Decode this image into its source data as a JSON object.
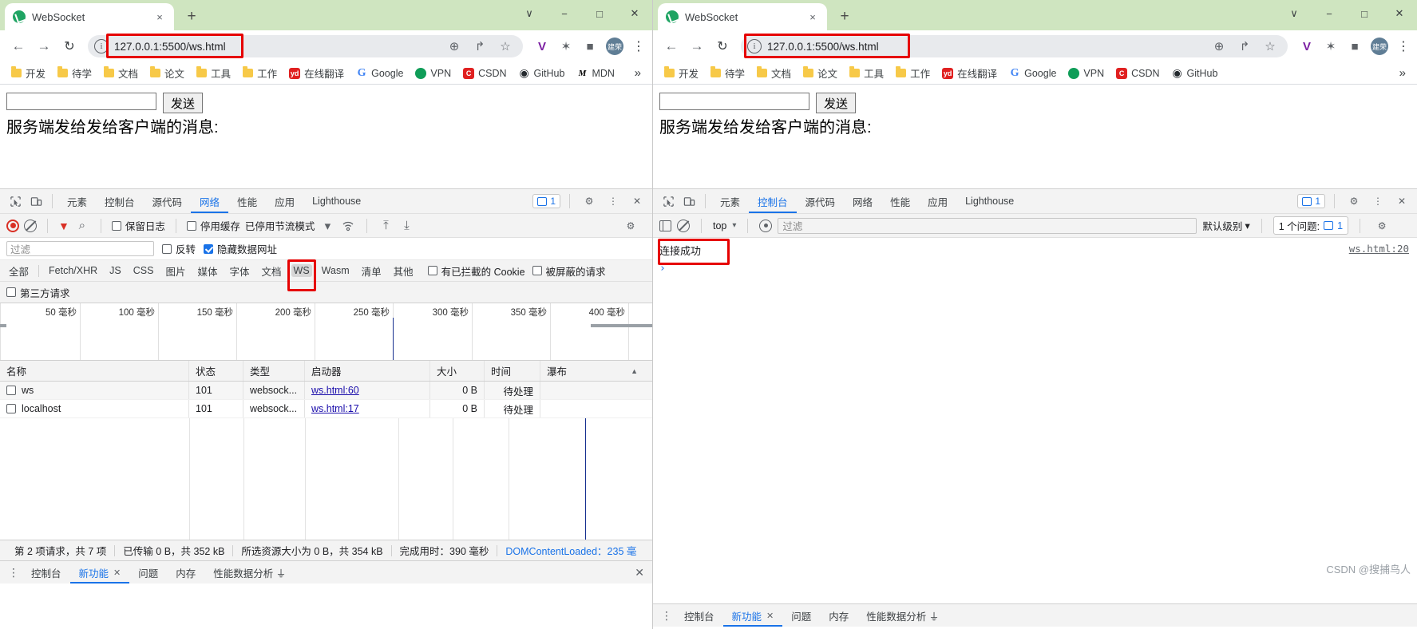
{
  "left_window": {
    "tab": {
      "title": "WebSocket",
      "close": "×",
      "favicon_name": "websocket-globe-icon"
    },
    "newtab_label": "+",
    "window_controls": {
      "chevron": "∨",
      "minimize": "−",
      "maximize": "□",
      "close": "✕"
    },
    "toolbar": {
      "back": "←",
      "forward": "→",
      "reload": "↻",
      "info": "ⓘ",
      "url": "127.0.0.1:5500/ws.html",
      "zoom_icon": "⊕",
      "share_icon": "↱",
      "star_icon": "☆",
      "ext1": "V",
      "ext2": "✶",
      "ext3": "■",
      "avatar": "建荣",
      "kebab": "⋮"
    },
    "bookmarks": [
      {
        "label": "开发",
        "icon": "folder-icon"
      },
      {
        "label": "待学",
        "icon": "folder-icon"
      },
      {
        "label": "文档",
        "icon": "folder-icon"
      },
      {
        "label": "论文",
        "icon": "folder-icon"
      },
      {
        "label": "工具",
        "icon": "folder-icon"
      },
      {
        "label": "工作",
        "icon": "folder-icon"
      },
      {
        "label": "在线翻译",
        "icon": "youdao-icon",
        "glyph": "yd"
      },
      {
        "label": "Google",
        "icon": "google-icon",
        "glyph": "G"
      },
      {
        "label": "VPN",
        "icon": "vpn-icon",
        "glyph": "●"
      },
      {
        "label": "CSDN",
        "icon": "csdn-icon",
        "glyph": "C"
      },
      {
        "label": "GitHub",
        "icon": "github-icon",
        "glyph": "●"
      },
      {
        "label": "MDN",
        "icon": "mdn-icon",
        "glyph": "M"
      }
    ],
    "bookmarks_overflow": "»",
    "page": {
      "input_value": "",
      "input_placeholder": "",
      "send_button": "发送",
      "server_text": "服务端发给发给客户端的消息:"
    },
    "devtools": {
      "tabs": [
        {
          "label": "元素",
          "active": false
        },
        {
          "label": "控制台",
          "active": false
        },
        {
          "label": "源代码",
          "active": false
        },
        {
          "label": "网络",
          "active": true
        },
        {
          "label": "性能",
          "active": false
        },
        {
          "label": "应用",
          "active": false
        },
        {
          "label": "Lighthouse",
          "active": false
        }
      ],
      "message_badge": "1",
      "settings_icon": "⚙",
      "kebab": "⋮",
      "close": "✕",
      "network_toolbar": {
        "record": "record-icon",
        "clear": "clear-icon",
        "filter": "▼",
        "search": "⌕",
        "preserve_log": "保留日志",
        "disable_cache": "停用缓存",
        "throttling": "已停用节流模式",
        "throttling_caret": "▾",
        "import": "⤒",
        "export": "⤓"
      },
      "filter_placeholder": "过滤",
      "invert_label": "反转",
      "hide_data_urls_label": "隐藏数据网址",
      "hide_data_urls_checked": true,
      "types": [
        "全部",
        "Fetch/XHR",
        "JS",
        "CSS",
        "图片",
        "媒体",
        "字体",
        "文档",
        "WS",
        "Wasm",
        "清单",
        "其他"
      ],
      "selected_type": "WS",
      "blocked_cookies_label": "有已拦截的 Cookie",
      "blocked_requests_label": "被屏蔽的请求",
      "third_party_label": "第三方请求",
      "timeline_ticks": [
        "50 毫秒",
        "100 毫秒",
        "150 毫秒",
        "200 毫秒",
        "250 毫秒",
        "300 毫秒",
        "350 毫秒",
        "400 毫秒"
      ],
      "table": {
        "columns": [
          "名称",
          "状态",
          "类型",
          "启动器",
          "大小",
          "时间",
          "瀑布"
        ],
        "sort_caret": "▲",
        "rows": [
          {
            "name": "ws",
            "status": "101",
            "type": "websock...",
            "initiator": "ws.html:60",
            "size": "0 B",
            "time": "待处理"
          },
          {
            "name": "localhost",
            "status": "101",
            "type": "websock...",
            "initiator": "ws.html:17",
            "size": "0 B",
            "time": "待处理"
          }
        ]
      },
      "status_bar": {
        "requests": "第 2 项请求，共 7 项",
        "transferred": "已传输 0 B，共 352 kB",
        "resources": "所选资源大小为 0 B，共 354 kB",
        "finish": "完成用时：390 毫秒",
        "domcontentloaded": "DOMContentLoaded：235 毫"
      },
      "drawer": {
        "kebab": "⋮",
        "tabs": [
          {
            "label": "控制台",
            "active": false,
            "closable": false
          },
          {
            "label": "新功能",
            "active": true,
            "closable": true
          },
          {
            "label": "问题",
            "active": false,
            "closable": false
          },
          {
            "label": "内存",
            "active": false,
            "closable": false
          },
          {
            "label": "性能数据分析 ⏚",
            "active": false,
            "closable": false
          }
        ],
        "close": "✕"
      }
    }
  },
  "right_window": {
    "tab": {
      "title": "WebSocket",
      "close": "×",
      "favicon_name": "websocket-globe-icon"
    },
    "newtab_label": "+",
    "window_controls": {
      "chevron": "∨",
      "minimize": "−",
      "maximize": "□",
      "close": "✕"
    },
    "toolbar": {
      "back": "←",
      "forward": "→",
      "reload": "↻",
      "info": "ⓘ",
      "url": "127.0.0.1:5500/ws.html",
      "zoom_icon": "⊕",
      "share_icon": "↱",
      "star_icon": "☆",
      "ext1": "V",
      "ext2": "✶",
      "ext3": "■",
      "avatar": "建荣",
      "kebab": "⋮"
    },
    "bookmarks": [
      {
        "label": "开发",
        "icon": "folder-icon"
      },
      {
        "label": "待学",
        "icon": "folder-icon"
      },
      {
        "label": "文档",
        "icon": "folder-icon"
      },
      {
        "label": "论文",
        "icon": "folder-icon"
      },
      {
        "label": "工具",
        "icon": "folder-icon"
      },
      {
        "label": "工作",
        "icon": "folder-icon"
      },
      {
        "label": "在线翻译",
        "icon": "youdao-icon",
        "glyph": "yd"
      },
      {
        "label": "Google",
        "icon": "google-icon",
        "glyph": "G"
      },
      {
        "label": "VPN",
        "icon": "vpn-icon",
        "glyph": "●"
      },
      {
        "label": "CSDN",
        "icon": "csdn-icon",
        "glyph": "C"
      },
      {
        "label": "GitHub",
        "icon": "github-icon",
        "glyph": "●"
      }
    ],
    "bookmarks_overflow": "»",
    "page": {
      "input_value": "",
      "input_placeholder": "",
      "send_button": "发送",
      "server_text": "服务端发给发给客户端的消息:"
    },
    "devtools": {
      "tabs": [
        {
          "label": "元素",
          "active": false
        },
        {
          "label": "控制台",
          "active": true
        },
        {
          "label": "源代码",
          "active": false
        },
        {
          "label": "网络",
          "active": false
        },
        {
          "label": "性能",
          "active": false
        },
        {
          "label": "应用",
          "active": false
        },
        {
          "label": "Lighthouse",
          "active": false
        }
      ],
      "message_badge": "1",
      "settings_icon": "⚙",
      "kebab": "⋮",
      "close": "✕",
      "console_toolbar": {
        "sidebar": "sidebar-icon",
        "clear": "clear-icon",
        "context": "top",
        "context_caret": "▾",
        "eye": "eye-icon",
        "filter_placeholder": "过滤",
        "level": "默认级别",
        "level_caret": "▾",
        "issues_label": "1 个问题:",
        "issues_count": "1",
        "settings": "⚙"
      },
      "messages": [
        {
          "text": "连接成功",
          "source": "ws.html:20",
          "highlighted": true
        }
      ],
      "prompt": "›",
      "drawer": {
        "kebab": "⋮",
        "tabs": [
          {
            "label": "控制台",
            "active": false,
            "closable": false
          },
          {
            "label": "新功能",
            "active": true,
            "closable": true
          },
          {
            "label": "问题",
            "active": false,
            "closable": false
          },
          {
            "label": "内存",
            "active": false,
            "closable": false
          },
          {
            "label": "性能数据分析 ⏚",
            "active": false,
            "closable": false
          }
        ]
      }
    },
    "watermark": "CSDN @搜捕鸟人"
  },
  "colors": {
    "tabstrip_green": "#cfe5c0",
    "accent_blue": "#1a73e8",
    "red_highlight": "#e60000",
    "link_purple": "#1a0dab"
  }
}
